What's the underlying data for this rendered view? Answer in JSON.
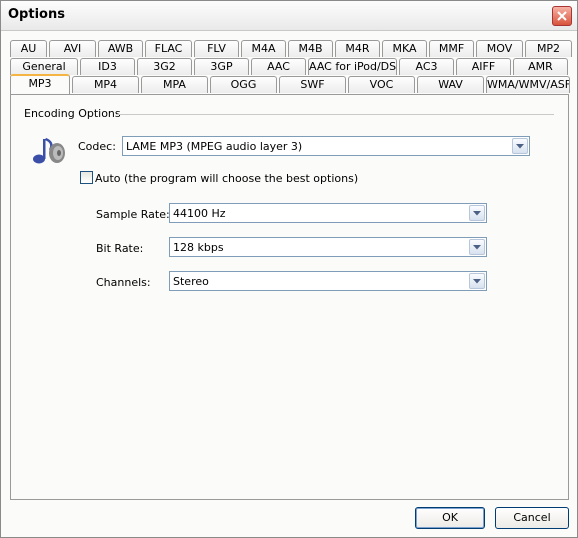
{
  "window": {
    "title": "Options"
  },
  "tabs": {
    "row1": [
      "AU",
      "AVI",
      "AWB",
      "FLAC",
      "FLV",
      "M4A",
      "M4B",
      "M4R",
      "MKA",
      "MMF",
      "MOV",
      "MP2"
    ],
    "row2": [
      "General",
      "ID3",
      "3G2",
      "3GP",
      "AAC",
      "AAC for iPod/DSi",
      "AC3",
      "AIFF",
      "AMR"
    ],
    "row3": [
      "MP3",
      "MP4",
      "MPA",
      "OGG",
      "SWF",
      "VOC",
      "WAV",
      "WMA/WMV/ASF"
    ],
    "active": "MP3"
  },
  "encoding": {
    "group_label": "Encoding Options",
    "codec_label": "Codec:",
    "codec_value": "LAME MP3 (MPEG audio layer 3)",
    "auto_label": "Auto (the program will choose the best options)",
    "auto_checked": false,
    "sample_rate_label": "Sample Rate:",
    "sample_rate_value": "44100 Hz",
    "bit_rate_label": "Bit Rate:",
    "bit_rate_value": "128 kbps",
    "channels_label": "Channels:",
    "channels_value": "Stereo"
  },
  "buttons": {
    "ok": "OK",
    "cancel": "Cancel"
  },
  "icons": {
    "close": "close-icon",
    "codec": "music-note-speaker-icon",
    "dropdown": "chevron-down-icon"
  }
}
